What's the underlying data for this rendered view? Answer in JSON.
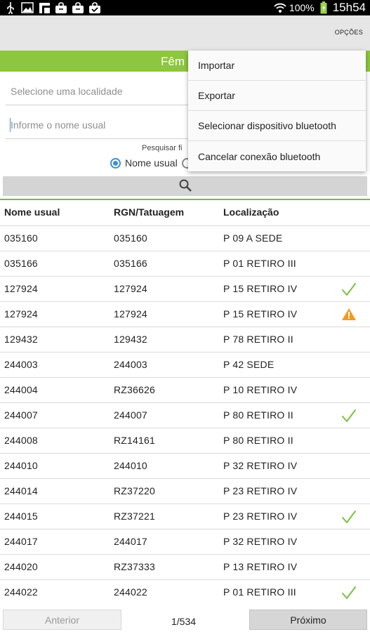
{
  "status_bar": {
    "battery_pct": "100%",
    "time": "15h54",
    "icons": [
      "usb-icon",
      "image-icon",
      "app-icon",
      "bag-icon",
      "bag-icon",
      "bag-check-icon",
      "wifi-icon",
      "battery-charging-icon"
    ]
  },
  "action_bar": {
    "options_label": "OPÇÕES"
  },
  "title_band": {
    "title": "Fêm"
  },
  "filters": {
    "locality_placeholder": "Selecione uma localidade",
    "name_placeholder": "Informe o nome usual",
    "search_by_label": "Pesquisar fi",
    "radio_name_label": "Nome usual",
    "radio_name_selected": true
  },
  "colors": {
    "accent_green": "#8dc63f",
    "check_green": "#7cc242",
    "warning_orange": "#f39a1e",
    "radio_blue": "#3b8fd8"
  },
  "table": {
    "headers": [
      "Nome usual",
      "RGN/Tatuagem",
      "Localização"
    ],
    "rows": [
      {
        "name": "035160",
        "rgn": "035160",
        "loc": "P 09 A SEDE",
        "status": ""
      },
      {
        "name": "035166",
        "rgn": "035166",
        "loc": "P 01 RETIRO III",
        "status": ""
      },
      {
        "name": "127924",
        "rgn": "127924",
        "loc": "P 15 RETIRO IV",
        "status": "check"
      },
      {
        "name": "127924",
        "rgn": "127924",
        "loc": "P 15 RETIRO IV",
        "status": "warning"
      },
      {
        "name": "129432",
        "rgn": "129432",
        "loc": "P 78 RETIRO II",
        "status": ""
      },
      {
        "name": "244003",
        "rgn": "244003",
        "loc": "P 42 SEDE",
        "status": ""
      },
      {
        "name": "244004",
        "rgn": "RZ36626",
        "loc": "P 10 RETIRO IV",
        "status": ""
      },
      {
        "name": "244007",
        "rgn": "244007",
        "loc": "P 80 RETIRO II",
        "status": "check"
      },
      {
        "name": "244008",
        "rgn": "RZ14161",
        "loc": "P 80 RETIRO II",
        "status": ""
      },
      {
        "name": "244010",
        "rgn": "244010",
        "loc": "P 32 RETIRO IV",
        "status": ""
      },
      {
        "name": "244014",
        "rgn": "RZ37220",
        "loc": "P 23 RETIRO IV",
        "status": ""
      },
      {
        "name": "244015",
        "rgn": "RZ37221",
        "loc": "P 23 RETIRO IV",
        "status": "check"
      },
      {
        "name": "244017",
        "rgn": "244017",
        "loc": "P 32 RETIRO IV",
        "status": ""
      },
      {
        "name": "244020",
        "rgn": "RZ37333",
        "loc": "P 13 RETIRO IV",
        "status": ""
      },
      {
        "name": "244022",
        "rgn": "244022",
        "loc": "P 01 RETIRO III",
        "status": "check"
      }
    ]
  },
  "pager": {
    "prev_label": "Anterior",
    "page_indicator": "1/534",
    "next_label": "Próximo"
  },
  "menu": {
    "items": [
      {
        "label": "Importar"
      },
      {
        "label": "Exportar"
      },
      {
        "label": "Selecionar dispositivo bluetooth"
      },
      {
        "label": "Cancelar conexão bluetooth"
      }
    ]
  }
}
